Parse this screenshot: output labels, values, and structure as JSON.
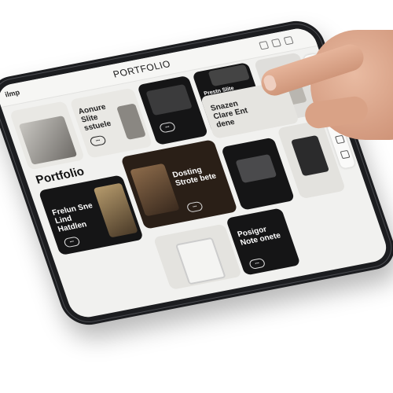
{
  "app": {
    "brand": "ilmp",
    "header_title": "PORTFOLIO",
    "section_title": "Portfolio"
  },
  "cards": {
    "card1": {
      "title": "Aonure Slite sstuele"
    },
    "card2": {
      "title": "Prestn Slite Reotet Cresi"
    },
    "card3": {
      "title": "Dosting Strote bete"
    },
    "card4": {
      "title": "Frelun Sne Lind Hatdlen"
    },
    "card5": {
      "title": "Snazen Clare Ent dene"
    },
    "card6": {
      "title": "Posigor Note onete"
    }
  },
  "icons": [
    "menu-icon",
    "search-icon",
    "share-icon",
    "settings-icon"
  ]
}
